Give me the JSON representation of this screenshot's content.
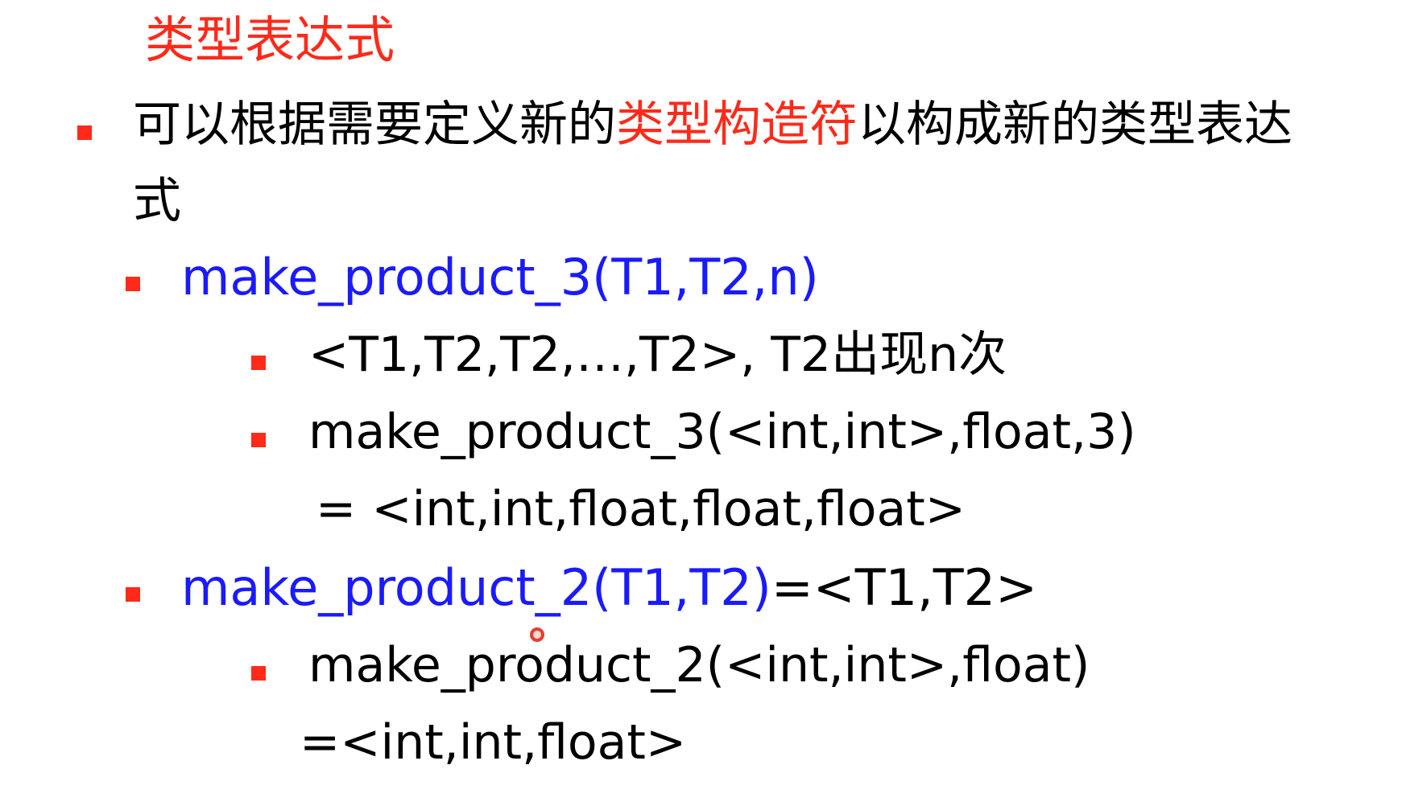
{
  "slide": {
    "title": "类型表达式",
    "colors": {
      "accent_red": "#ff2a1a",
      "code_blue": "#1a1aff",
      "text_black": "#000000"
    },
    "bullet1": {
      "text_before": "可以根据需要定义新的",
      "text_highlight": "类型构造符",
      "text_after": "以构成新的类型表达",
      "text_wrap": "式"
    },
    "bullet2": {
      "code": "make_product_3(T1,T2,n)"
    },
    "bullet2_sub1": {
      "text": "<T1,T2,T2,…,T2>, T2出现n次"
    },
    "bullet2_sub2": {
      "text": "make_product_3(<int,int>,float,3)",
      "result": "= <int,int,float,float,float>"
    },
    "bullet3": {
      "code": "make_product_2(T1,T2)",
      "rest": "=<T1,T2>"
    },
    "bullet3_sub1": {
      "text": "make_product_2(<int,int>,float)",
      "result": "=<int,int,float>"
    }
  }
}
